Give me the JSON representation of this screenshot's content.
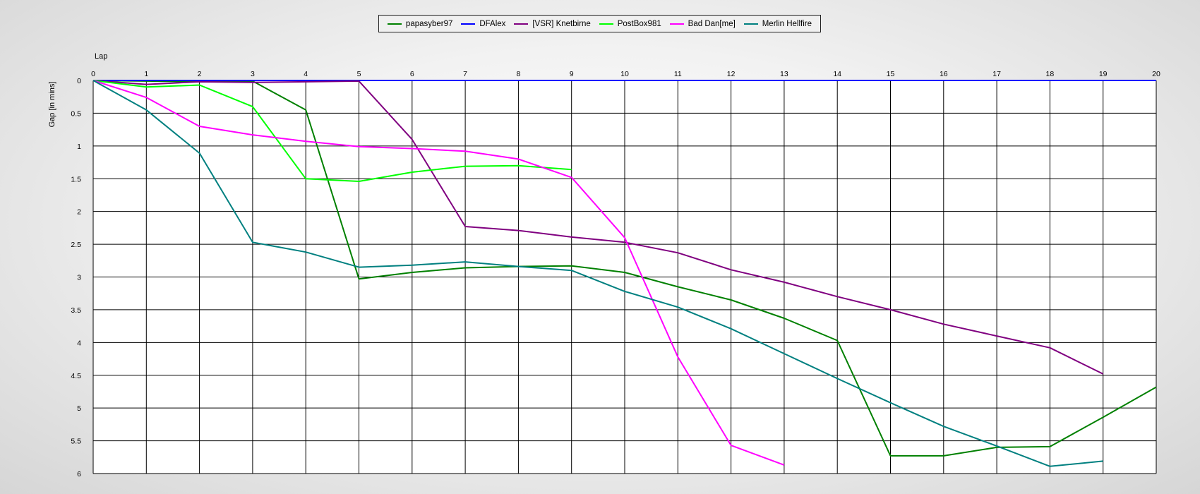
{
  "chart_data": {
    "type": "line",
    "xlabel": "Lap",
    "ylabel": "Gap [in mins]",
    "x": [
      0,
      1,
      2,
      3,
      4,
      5,
      6,
      7,
      8,
      9,
      10,
      11,
      12,
      13,
      14,
      15,
      16,
      17,
      18,
      19,
      20
    ],
    "xlim": [
      0,
      20
    ],
    "ylim": [
      0,
      6
    ],
    "y_inverted": true,
    "yticks": [
      0,
      0.5,
      1,
      1.5,
      2,
      2.5,
      3,
      3.5,
      4,
      4.5,
      5,
      5.5,
      6
    ],
    "grid": true,
    "legend_position": "top-center",
    "series": [
      {
        "name": "papasyber97",
        "color": "#008000",
        "values": [
          0,
          0.01,
          0.02,
          0.01,
          0.45,
          3.03,
          2.93,
          2.86,
          2.84,
          2.83,
          2.93,
          3.15,
          3.35,
          3.63,
          3.97,
          5.73,
          5.73,
          5.6,
          5.59,
          5.14,
          4.68
        ]
      },
      {
        "name": "DFAlex",
        "color": "#0000ff",
        "values": [
          0,
          0,
          0,
          0,
          0,
          0,
          0,
          0,
          0,
          0,
          0,
          0,
          0,
          0,
          0,
          0,
          0,
          0,
          0,
          0,
          0
        ]
      },
      {
        "name": "[VSR] Knetbirne",
        "color": "#800080",
        "values": [
          0,
          0.06,
          0.02,
          0.03,
          0.02,
          0.01,
          0.9,
          2.23,
          2.29,
          2.39,
          2.47,
          2.63,
          2.89,
          3.08,
          3.3,
          3.5,
          3.72,
          3.9,
          4.08,
          4.48,
          null
        ]
      },
      {
        "name": "PostBox981",
        "color": "#00ff00",
        "values": [
          0,
          0.1,
          0.07,
          0.4,
          1.5,
          1.54,
          1.4,
          1.31,
          1.3,
          1.36,
          null,
          null,
          null,
          null,
          null,
          null,
          null,
          null,
          null,
          null,
          null
        ]
      },
      {
        "name": "Bad Dan[me]",
        "color": "#ff00ff",
        "values": [
          0,
          0.26,
          0.7,
          0.83,
          0.93,
          1.01,
          1.04,
          1.08,
          1.2,
          1.48,
          2.4,
          4.22,
          5.57,
          5.87,
          null,
          null,
          null,
          null,
          null,
          null,
          null
        ]
      },
      {
        "name": "Merlin Hellfire",
        "color": "#008080",
        "values": [
          0,
          0.45,
          1.11,
          2.47,
          2.62,
          2.85,
          2.82,
          2.77,
          2.84,
          2.9,
          3.22,
          3.46,
          3.79,
          4.17,
          4.55,
          4.92,
          5.28,
          5.58,
          5.89,
          5.81,
          null
        ]
      }
    ]
  }
}
